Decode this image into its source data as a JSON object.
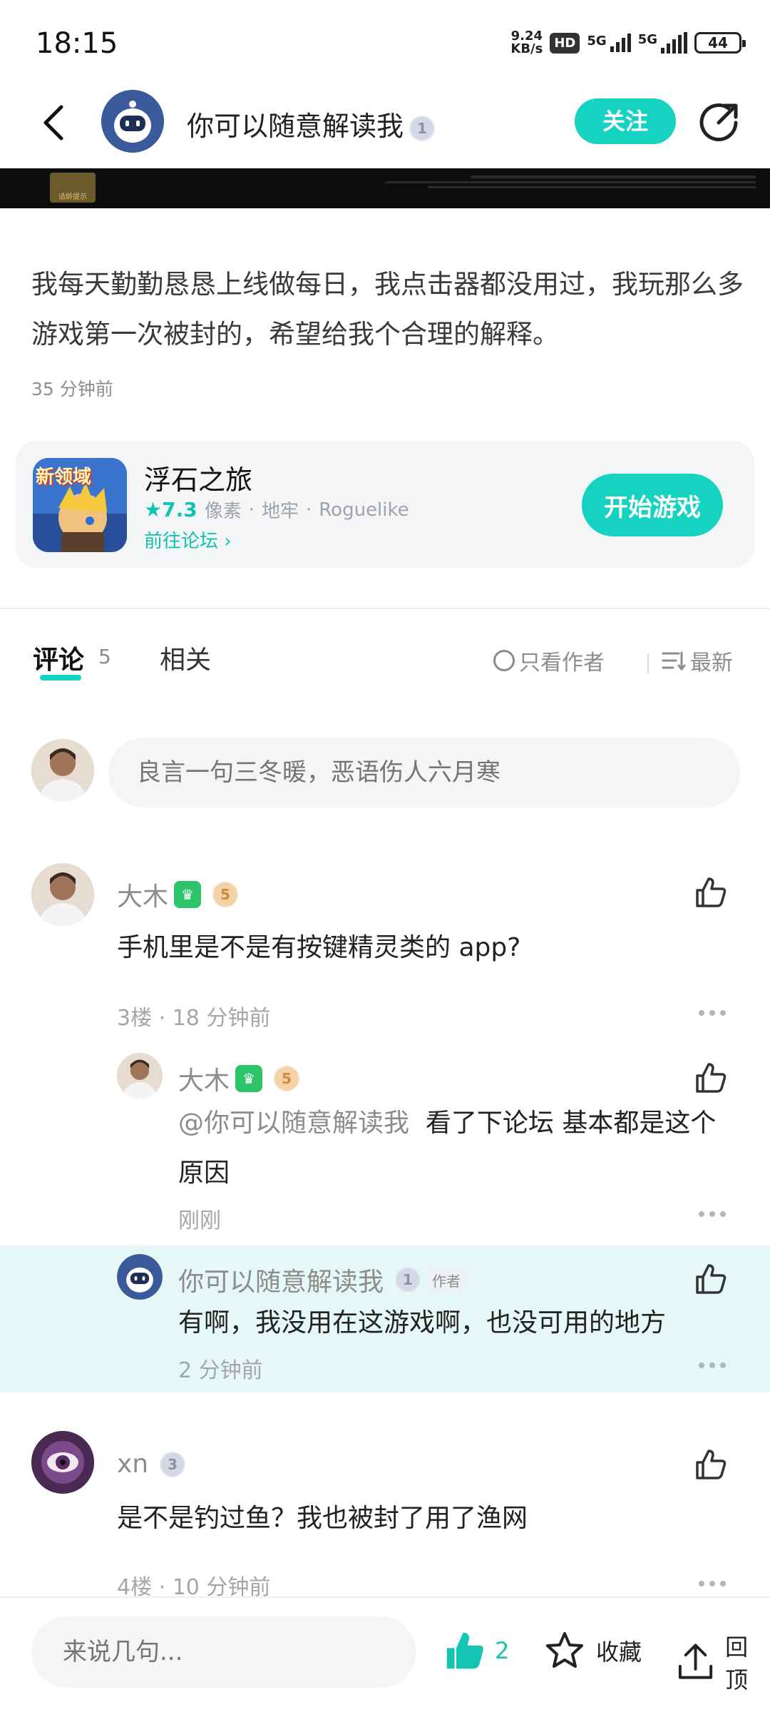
{
  "status_bar": {
    "time": "18:15",
    "net_speed_value": "9.24",
    "net_speed_unit": "KB/s",
    "hd_label": "HD",
    "signal1_label": "5G",
    "signal2_label": "5G",
    "battery_level": "44"
  },
  "header": {
    "author_name": "你可以随意解读我",
    "author_level": "1",
    "follow_label": "关注"
  },
  "post": {
    "age_tag": "适龄提示",
    "body": "我每天勤勤恳恳上线做每日，我点击器都没用过，我玩那么多游戏第一次被封的，希望给我个合理的解释。",
    "time": "35 分钟前"
  },
  "game_card": {
    "icon_text": "新领域",
    "title": "浮石之旅",
    "score": "★7.3",
    "tags": [
      "像素",
      "地牢",
      "Roguelike"
    ],
    "tag_sep": "·",
    "forum_link": "前往论坛 ›",
    "play_label": "开始游戏"
  },
  "tabs": {
    "comments_label": "评论",
    "comments_count": "5",
    "related_label": "相关",
    "author_only_label": "只看作者",
    "sort_label": "最新"
  },
  "comment_box": {
    "placeholder": "良言一句三冬暖，恶语伤人六月寒"
  },
  "comments": [
    {
      "name": "大木",
      "level": "5",
      "text": "手机里是不是有按键精灵类的 app?",
      "meta": "3楼 · 18 分钟前",
      "replies": [
        {
          "name": "大木",
          "level": "5",
          "mention": "@你可以随意解读我",
          "text": "看了下论坛 基本都是这个原因",
          "meta": "刚刚"
        },
        {
          "name": "你可以随意解读我",
          "level": "1",
          "author_tag": "作者",
          "text": "有啊，我没用在这游戏啊，也没可用的地方",
          "meta": "2 分钟前"
        }
      ]
    },
    {
      "name": "xn",
      "level": "3",
      "text": "是不是钓过鱼？我也被封了用了渔网",
      "meta": "4楼 · 10 分钟前"
    }
  ],
  "bottom_bar": {
    "input_placeholder": "来说几句...",
    "like_count": "2",
    "favorite_label": "收藏",
    "top_label": "回顶"
  },
  "colors": {
    "accent": "#16d2c1",
    "highlight_bg": "#e6f8f6"
  }
}
